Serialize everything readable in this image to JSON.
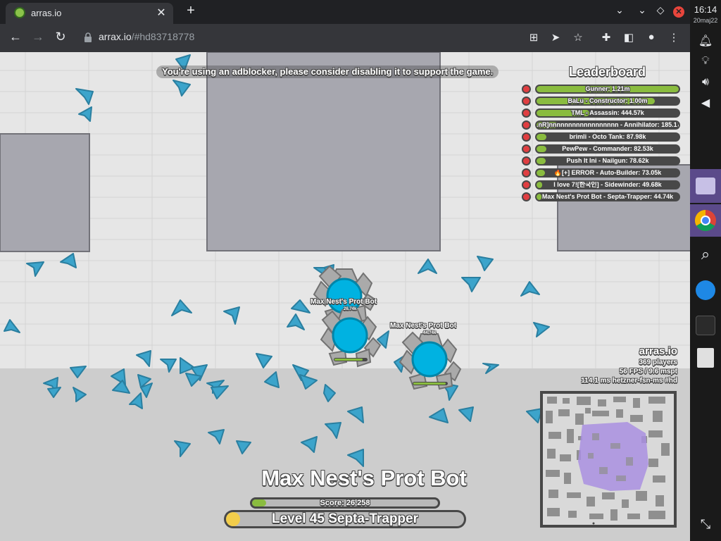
{
  "browser": {
    "tab_title": "arras.io",
    "tab_close": "✕",
    "new_tab": "+",
    "url_host": "arrax.io",
    "url_path": "/#hd83718778"
  },
  "system": {
    "time": "16:14",
    "date": "20maj22"
  },
  "game": {
    "adblock_notice": "You're using an adblocker, please consider disabling it to support the game.",
    "leaderboard_title": "Leaderboard",
    "leaderboard": [
      {
        "text": "Gunner: 1.21m",
        "fill": 1.0
      },
      {
        "text": "BaLu - Constructor: 1.00m",
        "fill": 0.83
      },
      {
        "text": "TML - Assassin: 444.57k",
        "fill": 0.37
      },
      {
        "text": ".nR]nnnnnnnnnnnnnnnnnn - Annihilator: 185.17k",
        "fill": 0.15
      },
      {
        "text": "brimli - Octo Tank: 87.98k",
        "fill": 0.07
      },
      {
        "text": "PewPew - Commander: 82.53k",
        "fill": 0.07
      },
      {
        "text": "Push It Ini - Nailgun: 78.62k",
        "fill": 0.065
      },
      {
        "text": "🔥[+] ERROR - Auto-Builder: 73.05k",
        "fill": 0.06
      },
      {
        "text": "I love 7![한국인] - Sidewinder: 49.68k",
        "fill": 0.04
      },
      {
        "text": "Max Nest's Prot Bot - Septa-Trapper: 44.74k",
        "fill": 0.037
      }
    ],
    "server": {
      "name": "arras.io",
      "players": "369 players",
      "fps": "56 FPS / 9.6 mspt",
      "ping": "114.1 ms  hetzner-fsn-ms #hd"
    },
    "tanks": [
      {
        "name": "Max Nest's Prot Bot",
        "score": "26.74k"
      },
      {
        "name": "Max Nest's Prot Bot",
        "score": "44.74k"
      }
    ],
    "player": {
      "name": "Max Nest's Prot Bot",
      "score_label": "Score: 26,258",
      "level_label": "Level 45 Septa-Trapper"
    },
    "colors": {
      "background": "#e6e6e6",
      "wall": "#a7a7af",
      "outline": "#484848",
      "team_blue": "#00b2e1",
      "trap": "#3ca4cb",
      "green": "#8abc3f",
      "enemy_red": "#e03e41"
    }
  }
}
